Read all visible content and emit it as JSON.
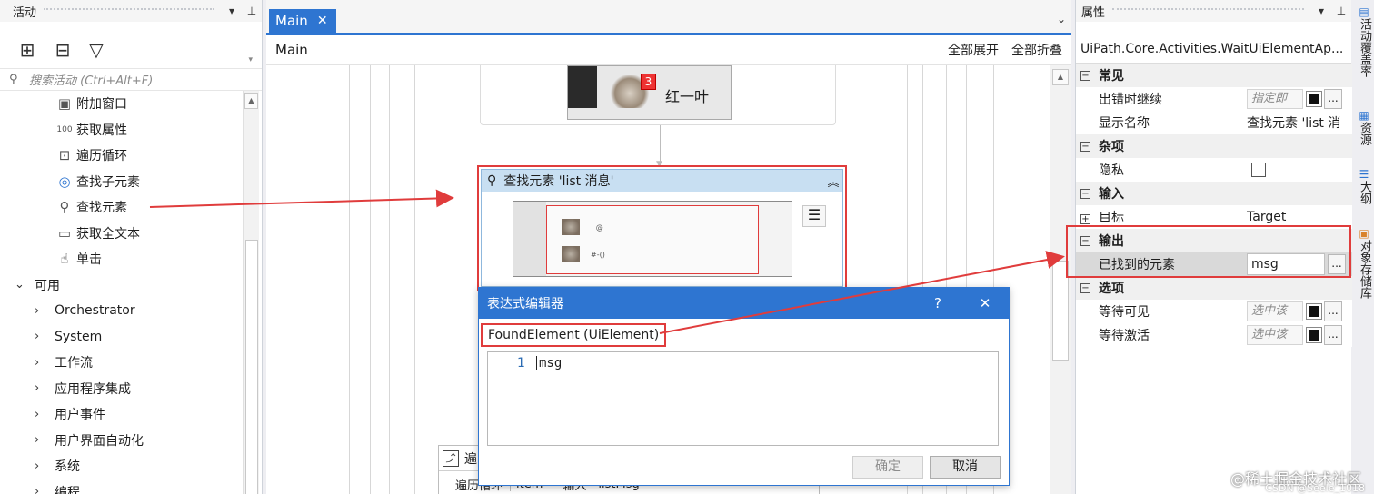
{
  "activities_panel": {
    "title": "活动",
    "search_placeholder": "搜索活动 (Ctrl+Alt+F)",
    "items": [
      {
        "label": "附加窗口",
        "icon": "attach-window-icon"
      },
      {
        "label": "获取属性",
        "icon": "get-attribute-icon"
      },
      {
        "label": "遍历循环",
        "icon": "for-each-icon"
      },
      {
        "label": "查找子元素",
        "icon": "find-children-icon"
      },
      {
        "label": "查找元素",
        "icon": "find-element-icon"
      },
      {
        "label": "获取全文本",
        "icon": "get-full-text-icon"
      },
      {
        "label": "单击",
        "icon": "click-icon"
      }
    ],
    "group_label": "可用",
    "categories": [
      "Orchestrator",
      "System",
      "工作流",
      "应用程序集成",
      "用户事件",
      "用户界面自动化",
      "系统",
      "编程"
    ]
  },
  "designer": {
    "tab_label": "Main",
    "breadcrumb": "Main",
    "expand_all": "全部展开",
    "collapse_all": "全部折叠",
    "top_element_name": "红一叶",
    "badge_count": "3",
    "find_activity_title": "查找元素 'list  消息'",
    "foreach": {
      "title": "遍",
      "label": "遍历循环",
      "item": "item",
      "in_label": "输入",
      "collection": "listMsg"
    }
  },
  "expression_editor": {
    "title": "表达式编辑器",
    "help": "?",
    "type_label": "FoundElement (UiElement)",
    "line_number": "1",
    "code": "msg",
    "ok_label": "确定",
    "cancel_label": "取消"
  },
  "properties": {
    "title": "属性",
    "type_name": "UiPath.Core.Activities.WaitUiElementAp...",
    "categories": {
      "common": "常见",
      "misc": "杂项",
      "input": "输入",
      "output": "输出",
      "options": "选项"
    },
    "rows": {
      "continue_on_error": {
        "name": "出错时继续",
        "placeholder": "指定即"
      },
      "display_name": {
        "name": "显示名称",
        "value": "查找元素 'list  消"
      },
      "private": {
        "name": "隐私"
      },
      "target": {
        "name": "目标",
        "value": "Target"
      },
      "found_element": {
        "name": "已找到的元素",
        "value": "msg"
      },
      "wait_visible": {
        "name": "等待可见",
        "placeholder": "选中该"
      },
      "wait_active": {
        "name": "等待激活",
        "placeholder": "选中该"
      }
    }
  },
  "right_tabs": [
    "活动覆盖率",
    "资源",
    "大纲",
    "对象存储库"
  ],
  "watermark": "@稀土掘金技术社区",
  "watermark_sub": "CSDN @Seele_1018",
  "colors": {
    "accent": "#2e75d1",
    "highlight": "#e03c3c"
  }
}
